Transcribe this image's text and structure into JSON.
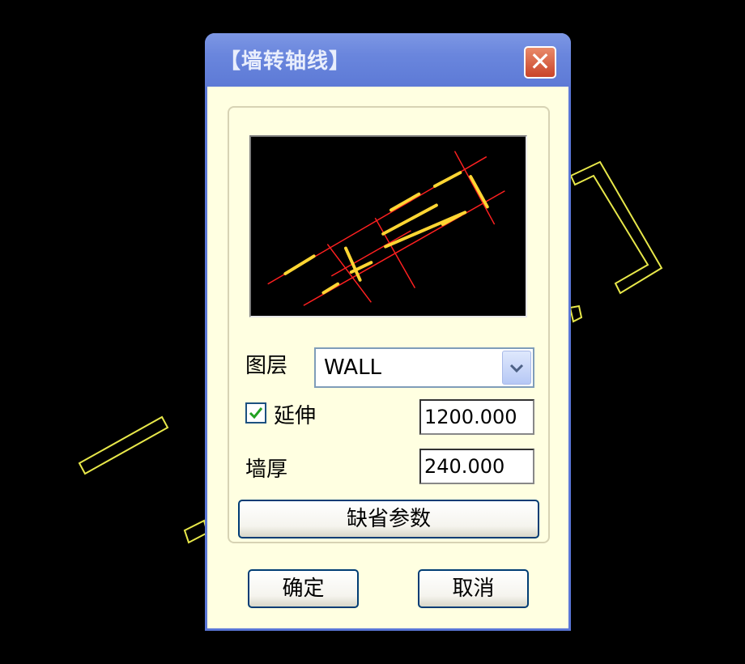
{
  "dialog": {
    "title": "【墙转轴线】",
    "close_label": "✕"
  },
  "form": {
    "layer_label": "图层",
    "layer_value": "WALL",
    "extend_label": "延伸",
    "extend_checked": true,
    "extend_value": "1200.000",
    "thickness_label": "墙厚",
    "thickness_value": "240.000",
    "defaults_button": "缺省参数"
  },
  "buttons": {
    "ok": "确定",
    "cancel": "取消"
  },
  "colors": {
    "wall": "#ffff33",
    "axis": "#ff2020",
    "title_bar": "#6a86dd",
    "dialog_bg": "#ffffe1"
  }
}
